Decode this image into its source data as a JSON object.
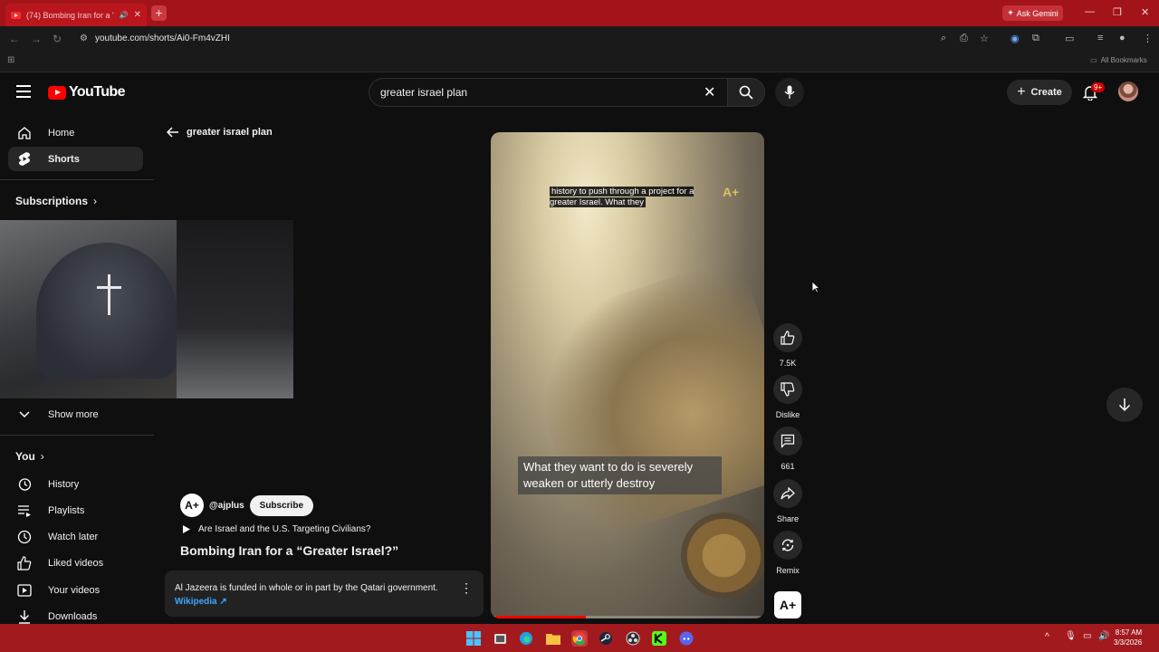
{
  "browser": {
    "tab_title": "(74) Bombing Iran for a \"Gr",
    "new_tab_label": "+",
    "ask_gemini": "Ask Gemini",
    "url": "youtube.com/shorts/Ai0-Fm4vZHI",
    "all_bookmarks": "All Bookmarks",
    "accent": "#a3141a"
  },
  "header": {
    "logo_text": "YouTube",
    "search_value": "greater israel plan",
    "create_label": "Create",
    "notifications_badge": "9+"
  },
  "sidebar": {
    "items": [
      {
        "label": "Home",
        "icon": "home-icon"
      },
      {
        "label": "Shorts",
        "icon": "shorts-icon"
      }
    ],
    "subscriptions_label": "Subscriptions",
    "show_more_label": "Show more",
    "you_label": "You",
    "you_items": [
      {
        "label": "History",
        "icon": "history-icon"
      },
      {
        "label": "Playlists",
        "icon": "playlists-icon"
      },
      {
        "label": "Watch later",
        "icon": "clock-icon"
      },
      {
        "label": "Liked videos",
        "icon": "thumbs-up-icon"
      },
      {
        "label": "Your videos",
        "icon": "video-icon"
      },
      {
        "label": "Downloads",
        "icon": "download-icon"
      }
    ]
  },
  "shorts": {
    "back_label": "greater israel plan",
    "caption_top": "history to push through a project for a greater Israel. What they",
    "caption_bottom": "What they want to do is severely weaken or utterly destroy",
    "progress": 0.33,
    "actions": {
      "like_count": "7.5K",
      "dislike_label": "Dislike",
      "comment_count": "661",
      "share_label": "Share",
      "remix_label": "Remix"
    },
    "channel_handle": "@ajplus",
    "subscribe_label": "Subscribe",
    "playlist_title": "Are Israel and the U.S. Targeting Civilians?",
    "title": "Bombing Iran for a “Greater Israel?”",
    "info_text": "Al Jazeera is funded in whole or in part by the Qatari government.",
    "info_link": "Wikipedia ↗"
  },
  "taskbar": {
    "time": "8:57 AM",
    "date": "3/3/2026"
  }
}
